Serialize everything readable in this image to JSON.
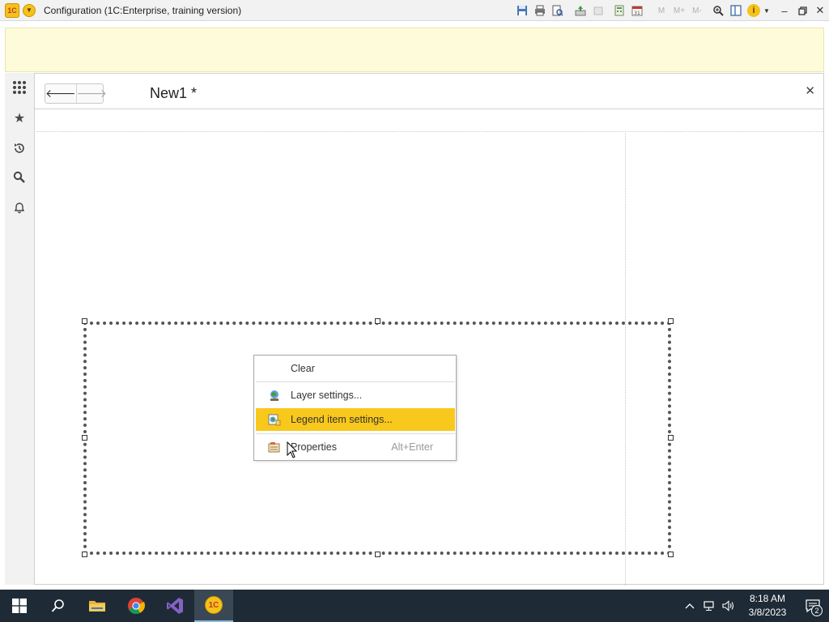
{
  "app": {
    "logo_text": "1С",
    "title": "Configuration  (1C:Enterprise, training version)"
  },
  "toolbar": {
    "icons": [
      "save-icon",
      "print-icon",
      "print-preview-icon",
      "upload-icon",
      "document-icon",
      "calculator-icon",
      "calendar-icon",
      "m-icon",
      "m-plus-icon",
      "m-minus-icon",
      "zoom-icon",
      "panels-icon",
      "info-icon"
    ],
    "m_label": "M",
    "m_plus_label": "M+",
    "m_minus_label": "M-",
    "calendar_day": "31",
    "info_label": "i"
  },
  "document": {
    "title": "New1 *"
  },
  "context_menu": {
    "items": [
      {
        "label": "Clear",
        "shortcut": ""
      },
      {
        "label": "Layer settings...",
        "shortcut": ""
      },
      {
        "label": "Legend item settings...",
        "shortcut": "",
        "highlighted": true
      },
      {
        "label": "Properties",
        "shortcut": "Alt+Enter"
      }
    ],
    "highlight_color": "#f8c81c"
  },
  "taskbar": {
    "time": "8:18 AM",
    "date": "3/8/2023",
    "notification_count": "2",
    "app_1c_label": "1С"
  },
  "colors": {
    "accent": "#f5c21a",
    "message_panel": "#fdfbd9",
    "taskbar": "#1e2b36"
  }
}
